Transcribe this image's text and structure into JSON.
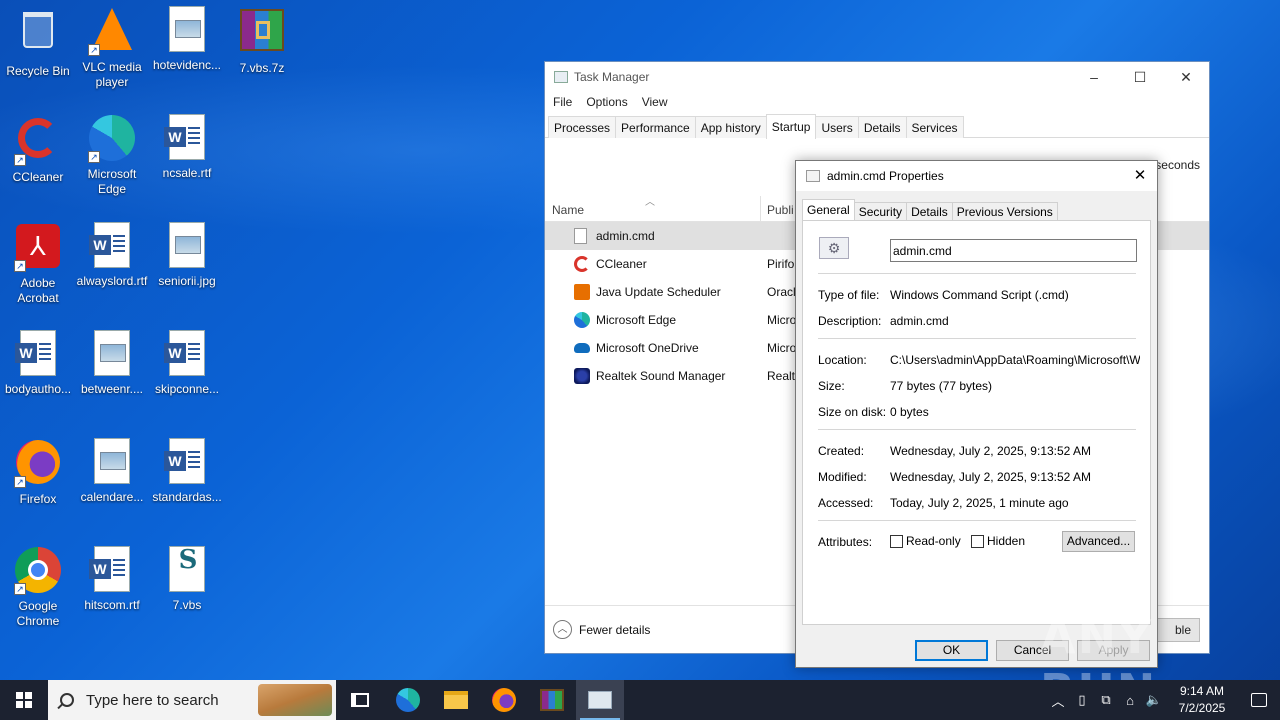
{
  "desktop": {
    "icons": [
      {
        "label": "Recycle Bin",
        "icon": "recycle-bin-icon"
      },
      {
        "label": "VLC media player",
        "icon": "vlc-icon"
      },
      {
        "label": "hotevidenc...",
        "icon": "image-file-icon"
      },
      {
        "label": "7.vbs.7z",
        "icon": "winrar-archive-icon"
      },
      {
        "label": "CCleaner",
        "icon": "ccleaner-icon"
      },
      {
        "label": "Microsoft Edge",
        "icon": "edge-icon"
      },
      {
        "label": "ncsale.rtf",
        "icon": "word-doc-icon"
      },
      {
        "label": "Adobe Acrobat",
        "icon": "acrobat-icon"
      },
      {
        "label": "alwayslord.rtf",
        "icon": "word-doc-icon"
      },
      {
        "label": "seniorii.jpg",
        "icon": "image-file-icon"
      },
      {
        "label": "bodyautho...",
        "icon": "word-doc-icon"
      },
      {
        "label": "betweenr....",
        "icon": "image-file-icon"
      },
      {
        "label": "skipconne...",
        "icon": "word-doc-icon"
      },
      {
        "label": "Firefox",
        "icon": "firefox-icon"
      },
      {
        "label": "calendare...",
        "icon": "image-file-icon"
      },
      {
        "label": "standardas...",
        "icon": "word-doc-icon"
      },
      {
        "label": "Google Chrome",
        "icon": "chrome-icon"
      },
      {
        "label": "hitscom.rtf",
        "icon": "word-doc-icon"
      },
      {
        "label": "7.vbs",
        "icon": "vbs-script-icon"
      }
    ]
  },
  "task_manager": {
    "title": "Task Manager",
    "menu": [
      "File",
      "Options",
      "View"
    ],
    "tabs": [
      "Processes",
      "Performance",
      "App history",
      "Startup",
      "Users",
      "Details",
      "Services"
    ],
    "active_tab": "Startup",
    "bios_time_suffix": "seconds",
    "columns": {
      "name": "Name",
      "publisher": "Publi"
    },
    "rows": [
      {
        "name": "admin.cmd",
        "publisher": "",
        "icon": "blank-file-icon",
        "selected": true
      },
      {
        "name": "CCleaner",
        "publisher": "Pirifo",
        "icon": "ccleaner-icon"
      },
      {
        "name": "Java Update Scheduler",
        "publisher": "Oracl",
        "icon": "java-icon"
      },
      {
        "name": "Microsoft Edge",
        "publisher": "Micro",
        "icon": "edge-icon"
      },
      {
        "name": "Microsoft OneDrive",
        "publisher": "Micro",
        "icon": "onedrive-icon"
      },
      {
        "name": "Realtek Sound Manager",
        "publisher": "Realte",
        "icon": "realtek-icon"
      }
    ],
    "fewer_details": "Fewer details",
    "disable_button": "ble"
  },
  "properties": {
    "title": "admin.cmd Properties",
    "tabs": [
      "General",
      "Security",
      "Details",
      "Previous Versions"
    ],
    "active_tab": "General",
    "filename": "admin.cmd",
    "fields": {
      "type_label": "Type of file:",
      "type_value": "Windows Command Script (.cmd)",
      "desc_label": "Description:",
      "desc_value": "admin.cmd",
      "location_label": "Location:",
      "location_value": "C:\\Users\\admin\\AppData\\Roaming\\Microsoft\\Wind",
      "size_label": "Size:",
      "size_value": "77 bytes (77 bytes)",
      "size_disk_label": "Size on disk:",
      "size_disk_value": "0 bytes",
      "created_label": "Created:",
      "created_value": "Wednesday, July 2, 2025, 9:13:52 AM",
      "modified_label": "Modified:",
      "modified_value": "Wednesday, July 2, 2025, 9:13:52 AM",
      "accessed_label": "Accessed:",
      "accessed_value": "Today, July 2, 2025, 1 minute ago",
      "attributes_label": "Attributes:"
    },
    "readonly_label": "Read-only",
    "hidden_label": "Hidden",
    "advanced_button": "Advanced...",
    "ok_button": "OK",
    "cancel_button": "Cancel",
    "apply_button": "Apply"
  },
  "watermark": "ANY RUN",
  "taskbar": {
    "search_placeholder": "Type here to search",
    "time": "9:14 AM",
    "date": "7/2/2025"
  },
  "colors": {
    "accent": "#0078d7",
    "taskbar": "#1c2230"
  }
}
